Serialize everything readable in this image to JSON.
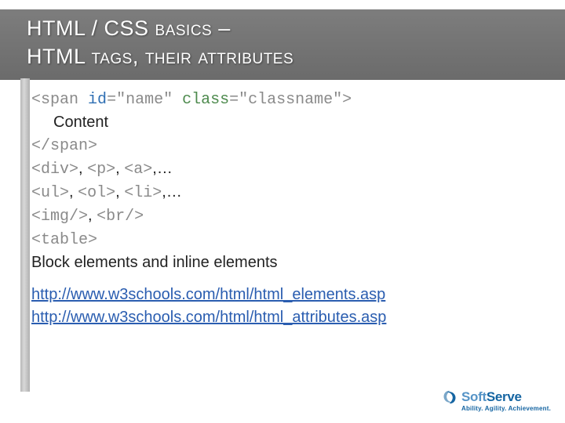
{
  "header": {
    "title_line1": "HTML / CSS basics –",
    "title_line2": "HTML tags, their attributes"
  },
  "code": {
    "open_lt": "<",
    "span_tag": "span",
    "space": " ",
    "id_attr": "id",
    "eq": "=",
    "id_val": "\"name\"",
    "class_attr": "class",
    "class_val": "\"classname\"",
    "close_gt": ">",
    "content": "Content",
    "close_span": "</span>",
    "line_div": "<div>",
    "comma": ", ",
    "line_p": "<p>",
    "line_a": "<a>",
    "ellipsis": ",…",
    "line_ul": "<ul>",
    "line_ol": "<ol>",
    "line_li": "<li>",
    "line_img": "<img/>",
    "line_br": "<br/>",
    "line_table": "<table>"
  },
  "text": {
    "block_inline": "Block elements and inline elements"
  },
  "links": {
    "elements": "http://www.w3schools.com/html/html_elements.asp",
    "attributes": "http://www.w3schools.com/html/html_attributes.asp"
  },
  "footer": {
    "brand_soft": "Soft",
    "brand_serve": "Serve",
    "tagline": "Ability. Agility. Achievement."
  }
}
